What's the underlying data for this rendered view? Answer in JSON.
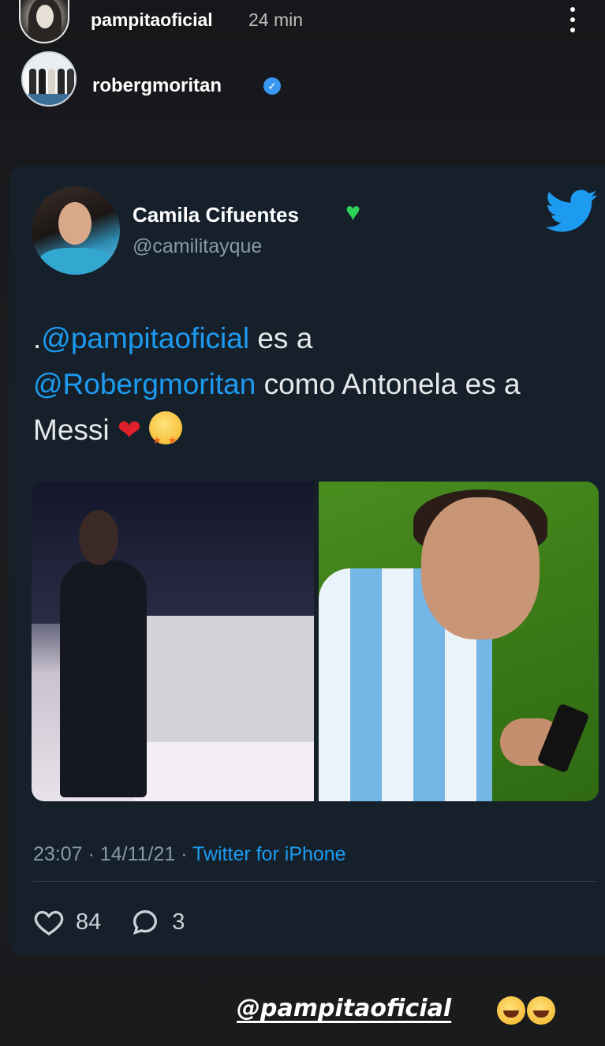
{
  "story": {
    "username": "pampitaoficial",
    "time": "24 min",
    "reposted_from": "robergmoritan"
  },
  "tweet": {
    "author_name": "Camila Cifuentes",
    "author_handle": "@camilitayque",
    "text_prefix": ".",
    "mention_1": "@pampitaoficial",
    "text_1": " es a ",
    "mention_2": "@Robergmoritan",
    "text_2": " como Antonela es a Messi ",
    "time": "23:07",
    "date": "14/11/21",
    "source": "Twitter for iPhone",
    "likes": "84",
    "replies": "3",
    "separator": "·"
  },
  "footer": {
    "mention": "@pampitaoficial"
  },
  "colors": {
    "card_bg": "#15202b",
    "twitter_blue": "#1d9bf0",
    "muted": "#8899a6"
  },
  "icons": [
    "more-icon",
    "verified-icon",
    "green-heart-icon",
    "twitter-bird-icon",
    "red-heart-icon",
    "star-struck-icon",
    "like-icon",
    "reply-icon",
    "laughing-icon"
  ]
}
